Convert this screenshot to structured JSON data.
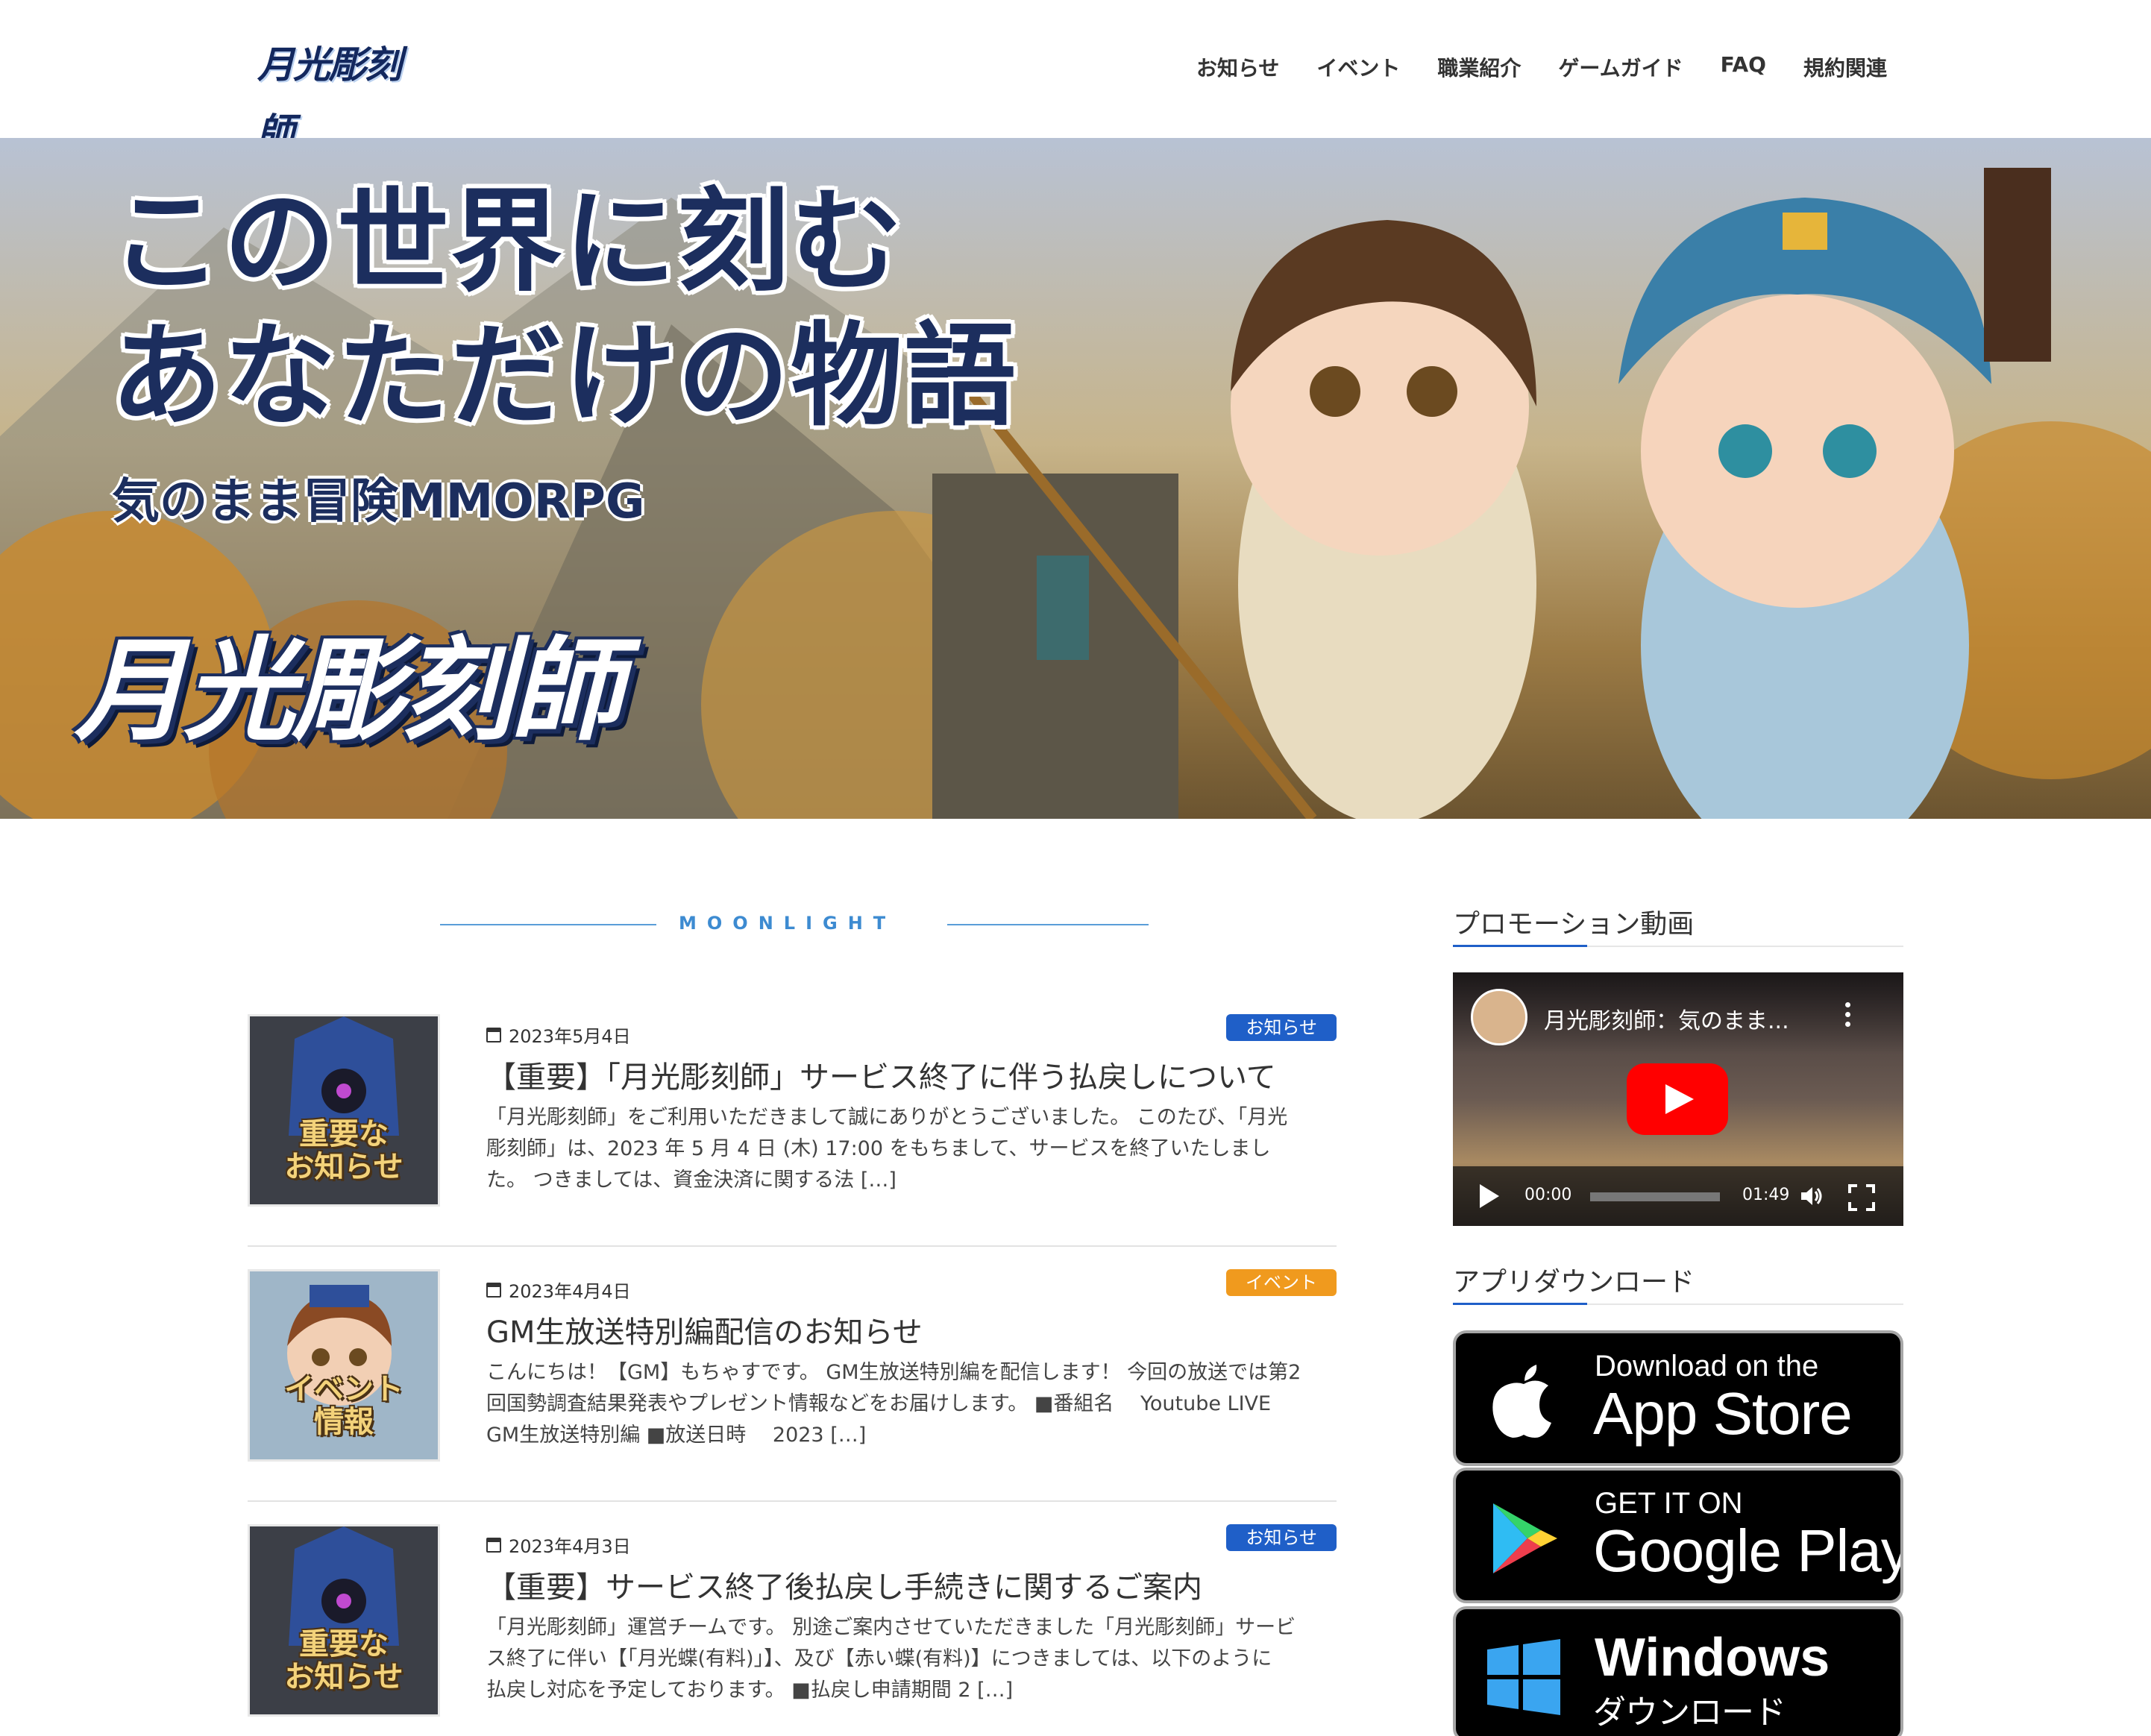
{
  "header": {
    "logo_text": "月光彫刻師",
    "nav": [
      "お知らせ",
      "イベント",
      "職業紹介",
      "ゲームガイド",
      "FAQ",
      "規約関連"
    ]
  },
  "hero": {
    "title_line1": "この世界に刻む",
    "title_line2": "あなただけの物語",
    "subtitle": "気のまま冒険MMORPG",
    "logo_text": "月光彫刻師"
  },
  "divider": {
    "text": "MOONLIGHT"
  },
  "posts": [
    {
      "date": "2023年5月4日",
      "category": "お知らせ",
      "category_color": "#1f5fc8",
      "thumb_caption_1": "重要な",
      "thumb_caption_2": "お知らせ",
      "title": "【重要】「月光彫刻師」サービス終了に伴う払戻しについて",
      "excerpt_1": "「月光彫刻師」をご利用いただきまして誠にありがとうございました。 このたび、「月光",
      "excerpt_2": "彫刻師」は、2023 年 5 月 4 日 (木) 17:00 をもちまして、サービスを終了いたしまし",
      "excerpt_3": "た。 つきましては、資金決済に関する法 […]"
    },
    {
      "date": "2023年4月4日",
      "category": "イベント",
      "category_color": "#f09a1e",
      "thumb_caption_1": "イベント",
      "thumb_caption_2": "情報",
      "title": "GM生放送特別編配信のお知らせ",
      "excerpt_1": "こんにちは！【GM】もちゃすです。 GM生放送特別編を配信します！ 今回の放送では第2",
      "excerpt_2": "回国勢調査結果発表やプレゼント情報などをお届けします。 ■番組名　 Youtube LIVE",
      "excerpt_3": "GM生放送特別編 ■放送日時　 2023 […]"
    },
    {
      "date": "2023年4月3日",
      "category": "お知らせ",
      "category_color": "#1f5fc8",
      "thumb_caption_1": "重要な",
      "thumb_caption_2": "お知らせ",
      "title": "【重要】サービス終了後払戻し手続きに関するご案内",
      "excerpt_1": "「月光彫刻師」運営チームです。 別途ご案内させていただきました「月光彫刻師」サービ",
      "excerpt_2": "ス終了に伴い【「月光蝶(有料)」】、及び【赤い蝶(有料)】につきましては、以下のように",
      "excerpt_3": "払戻し対応を予定しております。 ■払戻し申請期間 2 […]"
    }
  ],
  "sidebar": {
    "promo_heading": "プロモーション動画",
    "video": {
      "title": "月光彫刻師：気のまま...",
      "current_time": "00:00",
      "duration": "01:49"
    },
    "app_heading": "アプリダウンロード",
    "stores": [
      {
        "small": "Download on the",
        "big": "App Store",
        "icon": "apple-icon"
      },
      {
        "small": "GET IT ON",
        "big": "Google Play",
        "icon": "google-play-icon"
      },
      {
        "small": "Windows",
        "big": "ダウンロード",
        "icon": "windows-icon"
      }
    ]
  }
}
